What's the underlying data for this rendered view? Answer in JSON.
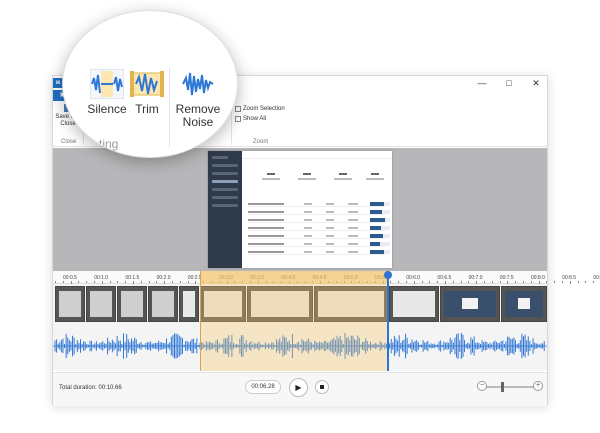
{
  "window": {
    "app_badge": "ж",
    "title": "— §",
    "controls": {
      "minimize": "—",
      "maximize": "□",
      "close": "✕"
    }
  },
  "ribbon": {
    "file_tab": "▣ ▾",
    "save_close": {
      "line1": "Save and",
      "line2": "Close"
    },
    "close_group": "Close",
    "partial_label": "ul",
    "zoom_selection": "Zoom Selection",
    "show_all": "Show All",
    "zoom_group": "Zoom"
  },
  "magnifier": {
    "silence": "Silence",
    "trim": "Trim",
    "remove_noise": {
      "line1": "Remove",
      "line2": "Noise"
    },
    "group_fragment": "ting"
  },
  "timeline": {
    "ticks": [
      "00:0.5",
      "00:1.0",
      "00:1.5",
      "00:2.0",
      "00:2.5",
      "00:3.0",
      "00:3.5",
      "00:4.0",
      "00:4.5",
      "00:5.0",
      "00:5.5",
      "00:6.0",
      "00:6.5",
      "00:7.0",
      "00:7.5",
      "00:8.0",
      "00:8.5",
      "00:9.0"
    ]
  },
  "controls": {
    "total_duration": "Total duration: 00:10.66",
    "current_time": "00:06.28",
    "play_glyph": "▶",
    "zoom_minus": "−",
    "zoom_plus": "+"
  },
  "colors": {
    "accent": "#1f6fc5",
    "selection": "#f6c86e",
    "waveform": "#2f77d6",
    "playhead": "#2d74d0"
  }
}
